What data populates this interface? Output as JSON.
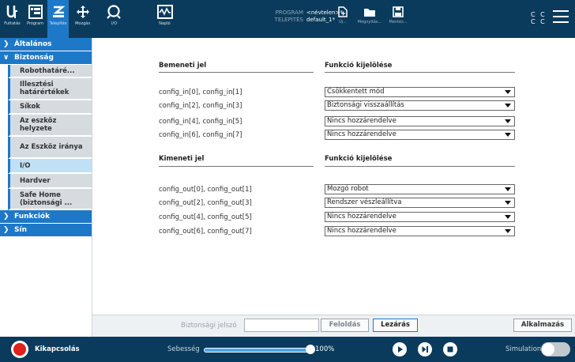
{
  "nav": {
    "items": [
      {
        "name": "nav-run",
        "label": "Futtatás"
      },
      {
        "name": "nav-program",
        "label": "Program"
      },
      {
        "name": "nav-install",
        "label": "Telepítés"
      },
      {
        "name": "nav-move",
        "label": "Mozgás"
      },
      {
        "name": "nav-io",
        "label": "I/O"
      },
      {
        "name": "nav-log",
        "label": "Napló"
      }
    ],
    "program_key": "PROGRAM",
    "program_val": "<névtelen>*",
    "install_key": "TELEPÍTÉS",
    "install_val": "default_1*",
    "new_label": "Új...",
    "open_label": "Megnyitás...",
    "save_label": "Mentés...",
    "cc1": "C C",
    "cc2": "C C"
  },
  "sidebar": {
    "general": "Általános",
    "safety": "Biztonság",
    "sub": [
      "Robothatáré...",
      "Illesztési határértékek",
      "Síkok",
      "Az eszköz helyzete",
      "Az Eszköz iránya",
      "I/O",
      "Hardver",
      "Safe Home (biztonsági ..."
    ],
    "functions": "Funkciók",
    "rail": "Sín"
  },
  "inputs": {
    "header_left": "Bemeneti jel",
    "header_right": "Funkció kijelölése",
    "rows": [
      {
        "label": "config_in[0], config_in[1]",
        "value": "Csökkentett mód"
      },
      {
        "label": "config_in[2], config_in[3]",
        "value": "Biztonsági visszaállítás"
      },
      {
        "label": "config_in[4], config_in[5]",
        "value": "Nincs hozzárendelve"
      },
      {
        "label": "config_in[6], config_in[7]",
        "value": "Nincs hozzárendelve"
      }
    ]
  },
  "outputs": {
    "header_left": "Kimeneti jel",
    "header_right": "Funkció kijelölése",
    "rows": [
      {
        "label": "config_out[0], config_out[1]",
        "value": "Mozgó robot"
      },
      {
        "label": "config_out[2], config_out[3]",
        "value": "Rendszer vészleállítva"
      },
      {
        "label": "config_out[4], config_out[5]",
        "value": "Nincs hozzárendelve"
      },
      {
        "label": "config_out[6], config_out[7]",
        "value": "Nincs hozzárendelve"
      }
    ]
  },
  "actions": {
    "password_label": "Biztonsági jelszó",
    "password_value": "",
    "unlock": "Feloldás",
    "lock": "Lezárás",
    "apply": "Alkalmazás"
  },
  "footer": {
    "power": "Kikapcsolás",
    "speed": "Sebesség",
    "speed_pct": "100%",
    "speed_fraction": 1.0,
    "simulation": "Simulation",
    "simulation_on": false
  },
  "colors": {
    "topbar": "#0b3b5c",
    "accent": "#1e78c8",
    "active_sub": "#bfe0f5",
    "power": "#e0201b"
  }
}
